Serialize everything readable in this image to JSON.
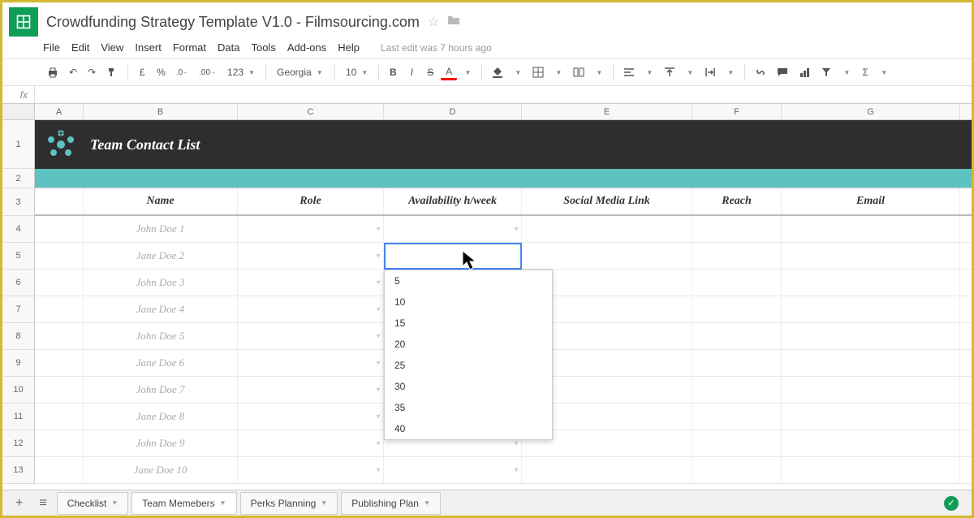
{
  "title": "Crowdfunding Strategy Template V1.0 - Filmsourcing.com",
  "menus": [
    "File",
    "Edit",
    "View",
    "Insert",
    "Format",
    "Data",
    "Tools",
    "Add-ons",
    "Help"
  ],
  "last_edit": "Last edit was 7 hours ago",
  "toolbar": {
    "currency": "£",
    "percent": "%",
    "dec_dec": ".0",
    "dec_inc": ".00",
    "numfmt": "123",
    "font": "Georgia",
    "size": "10",
    "bold": "B",
    "italic": "I",
    "strike": "S",
    "underline_a": "A",
    "sigma": "Σ"
  },
  "fx": "fx",
  "columns": [
    "A",
    "B",
    "C",
    "D",
    "E",
    "F",
    "G"
  ],
  "row_labels": [
    "1",
    "2",
    "3",
    "4",
    "5",
    "6",
    "7",
    "8",
    "9",
    "10",
    "11",
    "12",
    "13"
  ],
  "banner_title": "Team Contact List",
  "headers": {
    "name": "Name",
    "role": "Role",
    "availability": "Availability h/week",
    "social": "Social Media Link",
    "reach": "Reach",
    "email": "Email"
  },
  "names": [
    "John Doe 1",
    "Jane Doe 2",
    "John Doe 3",
    "Jane Doe 4",
    "John Doe 5",
    "Jane Doe 6",
    "John Doe 7",
    "Jane Doe 8",
    "John Doe 9",
    "Jane Doe 10"
  ],
  "dropdown_options": [
    "5",
    "10",
    "15",
    "20",
    "25",
    "30",
    "35",
    "40"
  ],
  "tabs": {
    "checklist": "Checklist",
    "team": "Team Memebers",
    "perks": "Perks Planning",
    "publishing": "Publishing Plan"
  }
}
